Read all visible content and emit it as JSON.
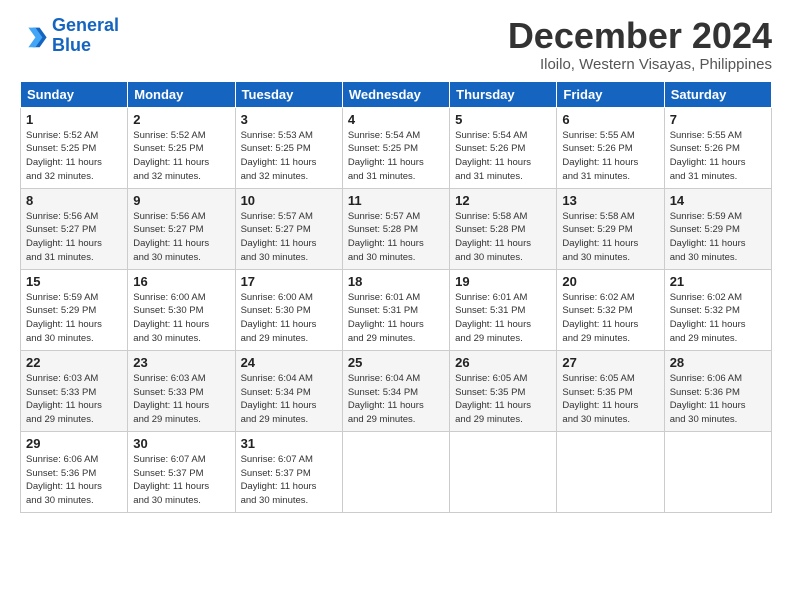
{
  "logo": {
    "line1": "General",
    "line2": "Blue"
  },
  "title": "December 2024",
  "subtitle": "Iloilo, Western Visayas, Philippines",
  "days_of_week": [
    "Sunday",
    "Monday",
    "Tuesday",
    "Wednesday",
    "Thursday",
    "Friday",
    "Saturday"
  ],
  "weeks": [
    [
      {
        "day": "1",
        "info": "Sunrise: 5:52 AM\nSunset: 5:25 PM\nDaylight: 11 hours\nand 32 minutes."
      },
      {
        "day": "2",
        "info": "Sunrise: 5:52 AM\nSunset: 5:25 PM\nDaylight: 11 hours\nand 32 minutes."
      },
      {
        "day": "3",
        "info": "Sunrise: 5:53 AM\nSunset: 5:25 PM\nDaylight: 11 hours\nand 32 minutes."
      },
      {
        "day": "4",
        "info": "Sunrise: 5:54 AM\nSunset: 5:25 PM\nDaylight: 11 hours\nand 31 minutes."
      },
      {
        "day": "5",
        "info": "Sunrise: 5:54 AM\nSunset: 5:26 PM\nDaylight: 11 hours\nand 31 minutes."
      },
      {
        "day": "6",
        "info": "Sunrise: 5:55 AM\nSunset: 5:26 PM\nDaylight: 11 hours\nand 31 minutes."
      },
      {
        "day": "7",
        "info": "Sunrise: 5:55 AM\nSunset: 5:26 PM\nDaylight: 11 hours\nand 31 minutes."
      }
    ],
    [
      {
        "day": "8",
        "info": "Sunrise: 5:56 AM\nSunset: 5:27 PM\nDaylight: 11 hours\nand 31 minutes."
      },
      {
        "day": "9",
        "info": "Sunrise: 5:56 AM\nSunset: 5:27 PM\nDaylight: 11 hours\nand 30 minutes."
      },
      {
        "day": "10",
        "info": "Sunrise: 5:57 AM\nSunset: 5:27 PM\nDaylight: 11 hours\nand 30 minutes."
      },
      {
        "day": "11",
        "info": "Sunrise: 5:57 AM\nSunset: 5:28 PM\nDaylight: 11 hours\nand 30 minutes."
      },
      {
        "day": "12",
        "info": "Sunrise: 5:58 AM\nSunset: 5:28 PM\nDaylight: 11 hours\nand 30 minutes."
      },
      {
        "day": "13",
        "info": "Sunrise: 5:58 AM\nSunset: 5:29 PM\nDaylight: 11 hours\nand 30 minutes."
      },
      {
        "day": "14",
        "info": "Sunrise: 5:59 AM\nSunset: 5:29 PM\nDaylight: 11 hours\nand 30 minutes."
      }
    ],
    [
      {
        "day": "15",
        "info": "Sunrise: 5:59 AM\nSunset: 5:29 PM\nDaylight: 11 hours\nand 30 minutes."
      },
      {
        "day": "16",
        "info": "Sunrise: 6:00 AM\nSunset: 5:30 PM\nDaylight: 11 hours\nand 30 minutes."
      },
      {
        "day": "17",
        "info": "Sunrise: 6:00 AM\nSunset: 5:30 PM\nDaylight: 11 hours\nand 29 minutes."
      },
      {
        "day": "18",
        "info": "Sunrise: 6:01 AM\nSunset: 5:31 PM\nDaylight: 11 hours\nand 29 minutes."
      },
      {
        "day": "19",
        "info": "Sunrise: 6:01 AM\nSunset: 5:31 PM\nDaylight: 11 hours\nand 29 minutes."
      },
      {
        "day": "20",
        "info": "Sunrise: 6:02 AM\nSunset: 5:32 PM\nDaylight: 11 hours\nand 29 minutes."
      },
      {
        "day": "21",
        "info": "Sunrise: 6:02 AM\nSunset: 5:32 PM\nDaylight: 11 hours\nand 29 minutes."
      }
    ],
    [
      {
        "day": "22",
        "info": "Sunrise: 6:03 AM\nSunset: 5:33 PM\nDaylight: 11 hours\nand 29 minutes."
      },
      {
        "day": "23",
        "info": "Sunrise: 6:03 AM\nSunset: 5:33 PM\nDaylight: 11 hours\nand 29 minutes."
      },
      {
        "day": "24",
        "info": "Sunrise: 6:04 AM\nSunset: 5:34 PM\nDaylight: 11 hours\nand 29 minutes."
      },
      {
        "day": "25",
        "info": "Sunrise: 6:04 AM\nSunset: 5:34 PM\nDaylight: 11 hours\nand 29 minutes."
      },
      {
        "day": "26",
        "info": "Sunrise: 6:05 AM\nSunset: 5:35 PM\nDaylight: 11 hours\nand 29 minutes."
      },
      {
        "day": "27",
        "info": "Sunrise: 6:05 AM\nSunset: 5:35 PM\nDaylight: 11 hours\nand 30 minutes."
      },
      {
        "day": "28",
        "info": "Sunrise: 6:06 AM\nSunset: 5:36 PM\nDaylight: 11 hours\nand 30 minutes."
      }
    ],
    [
      {
        "day": "29",
        "info": "Sunrise: 6:06 AM\nSunset: 5:36 PM\nDaylight: 11 hours\nand 30 minutes."
      },
      {
        "day": "30",
        "info": "Sunrise: 6:07 AM\nSunset: 5:37 PM\nDaylight: 11 hours\nand 30 minutes."
      },
      {
        "day": "31",
        "info": "Sunrise: 6:07 AM\nSunset: 5:37 PM\nDaylight: 11 hours\nand 30 minutes."
      },
      {
        "day": "",
        "info": ""
      },
      {
        "day": "",
        "info": ""
      },
      {
        "day": "",
        "info": ""
      },
      {
        "day": "",
        "info": ""
      }
    ]
  ]
}
